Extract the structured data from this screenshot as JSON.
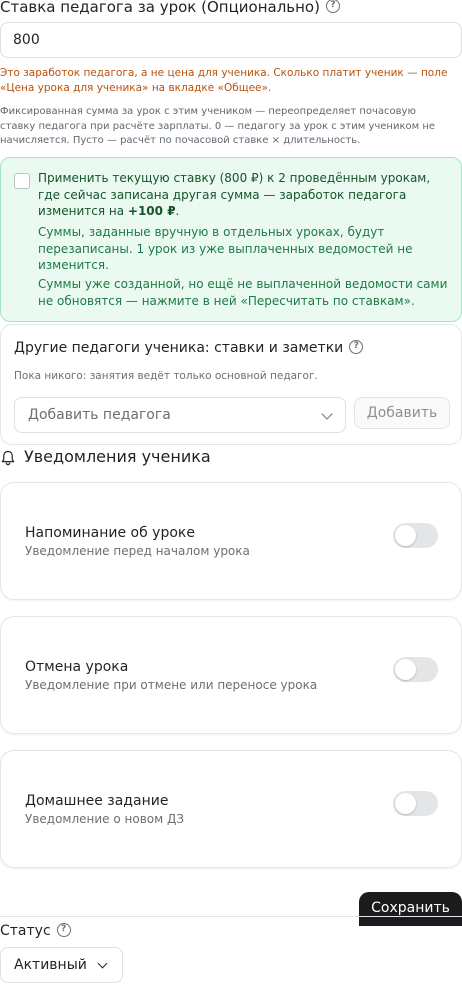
{
  "rate": {
    "label": "Ставка педагога за урок (Опционально)",
    "help_icon": "?",
    "value": "800",
    "warning": "Это заработок педагога, а не цена для ученика. Сколько платит ученик — поле «Цена урока для ученика» на вкладке «Общее».",
    "hint": "Фиксированная сумма за урок с этим учеником — переопределяет почасовую ставку педагога при расчёте зарплаты. 0 — педагогу за урок с этим учеником не начисляется. Пусто — расчёт по почасовой ставке × длительность."
  },
  "apply_box": {
    "text_prefix": "Применить текущую ставку (800 ₽) к 2 проведённым урокам, где сейчас записана другая сумма — заработок педагога изменится на ",
    "text_amount": "+100 ₽",
    "text_suffix": ".",
    "note_1": "Суммы, заданные вручную в отдельных уроках, будут перезаписаны. 1 урок из уже выплаченных ведомостей не изменится.",
    "note_2": "Суммы уже созданной, но ещё не выплаченной ведомости сами не обновятся — нажмите в ней «Пересчитать по ставкам».",
    "checked": false
  },
  "teachers": {
    "title": "Другие педагоги ученика: ставки и заметки",
    "help_icon": "?",
    "empty_text": "Пока никого: занятия ведёт только основной педагог.",
    "select_placeholder": "Добавить педагога",
    "add_button": "Добавить"
  },
  "notifications": {
    "title": "Уведомления ученика",
    "icon": "bell-icon",
    "items": [
      {
        "title": "Напоминание об уроке",
        "description": "Уведомление перед началом урока",
        "enabled": false
      },
      {
        "title": "Отмена урока",
        "description": "Уведомление при отмене или переносе урока",
        "enabled": false
      },
      {
        "title": "Домашнее задание",
        "description": "Уведомление о новом ДЗ",
        "enabled": false
      }
    ]
  },
  "save_button": "Сохранить",
  "status": {
    "label": "Статус",
    "help_icon": "?",
    "value": "Активный"
  },
  "colors": {
    "warning": "#b8510d",
    "success_bg": "#eafaf1",
    "success_border": "#a5e5c2",
    "success_text": "#14532d",
    "primary_button": "#1a1b1d",
    "toggle_off": "#e4e5e7"
  }
}
